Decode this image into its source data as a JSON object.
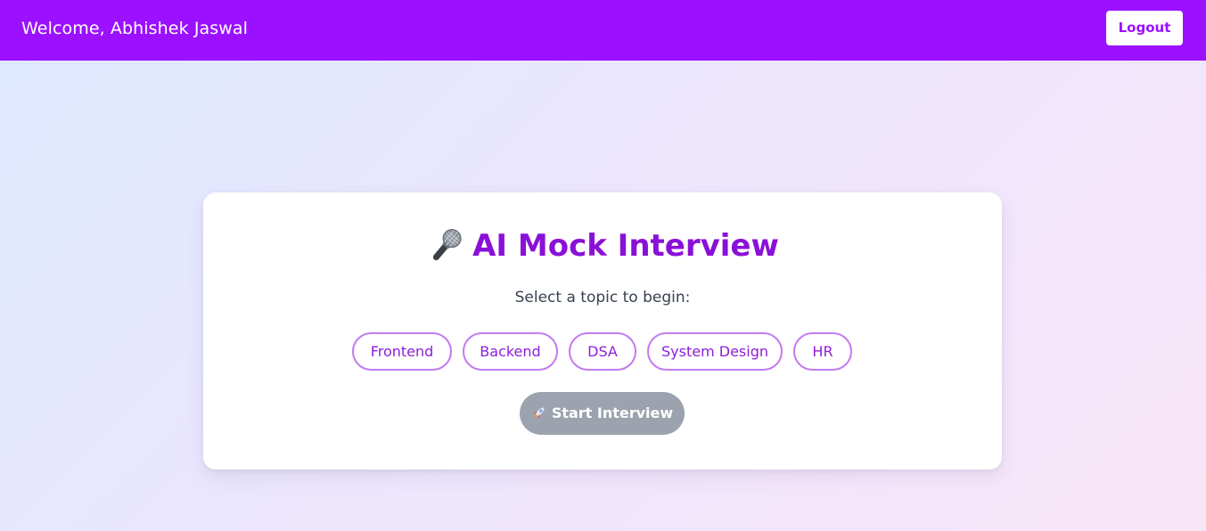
{
  "header": {
    "welcome_text": "Welcome, Abhishek Jaswal",
    "logout_label": "Logout",
    "background_color": "#9b11ff"
  },
  "card": {
    "title_icon": "microphone-icon",
    "title": "AI Mock Interview",
    "subtitle": "Select a topic to begin:",
    "topics": [
      {
        "label": "Frontend"
      },
      {
        "label": "Backend"
      },
      {
        "label": "DSA"
      },
      {
        "label": "System Design"
      },
      {
        "label": "HR"
      }
    ],
    "start_button": {
      "icon": "rocket-icon",
      "label": "Start Interview",
      "state": "disabled"
    }
  },
  "colors": {
    "accent": "#9b11ff",
    "title": "#8a10d8",
    "topic_border": "#c47af0",
    "disabled_button": "#9ca3af"
  }
}
